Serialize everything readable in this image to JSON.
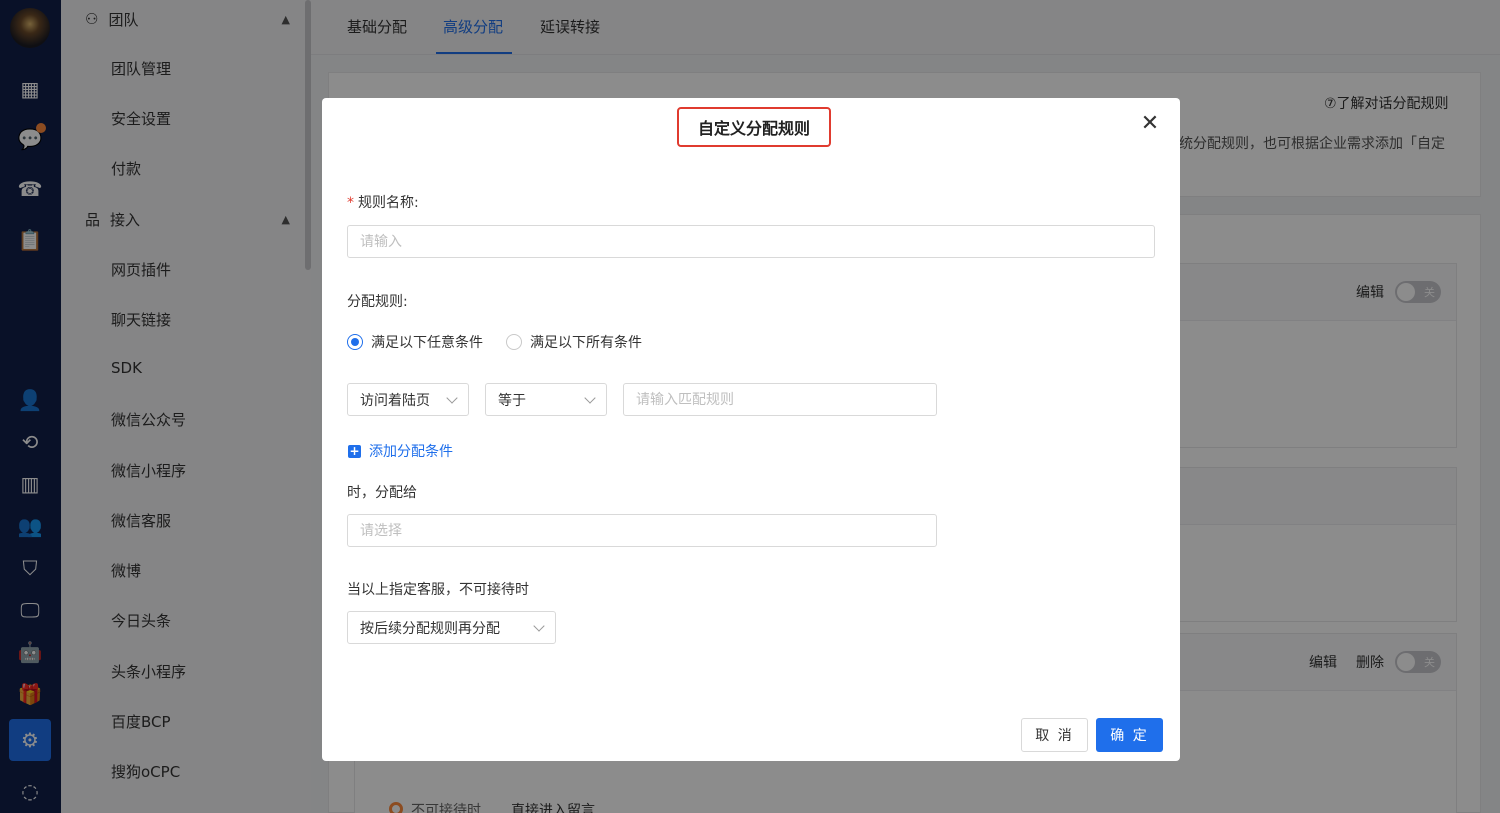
{
  "rail": {
    "icons": [
      "dashboard-icon",
      "chat-icon",
      "phone-icon",
      "clipboard-icon",
      "user-icon",
      "history-icon",
      "bar-chart-icon",
      "team-icon",
      "shield-icon",
      "monitor-icon",
      "robot-icon",
      "gift-icon",
      "settings-icon",
      "whatsapp-icon"
    ]
  },
  "sidebar": {
    "group_team": "团队",
    "team_items": [
      "团队管理",
      "安全设置",
      "付款"
    ],
    "group_access": "接入",
    "access_items": [
      "网页插件",
      "聊天链接",
      "SDK",
      "微信公众号",
      "微信小程序",
      "微信客服",
      "微博",
      "今日头条",
      "头条小程序",
      "百度BCP",
      "搜狗oCPC"
    ]
  },
  "tabs": [
    "基础分配",
    "高级分配",
    "延误转接"
  ],
  "background": {
    "help_link": "⑦了解对话分配规则",
    "desc_fragment": "统分配规则，也可根据企业需求添加「自定",
    "edit": "编辑",
    "delete": "删除",
    "toggle_off": "关",
    "row_label_unavailable": "不可接待时",
    "row_value_unavailable": "直接进入留言"
  },
  "modal": {
    "title": "自定义分配规则",
    "rule_name_label": "规则名称:",
    "rule_name_placeholder": "请输入",
    "assign_rule_label": "分配规则:",
    "radio_any": "满足以下任意条件",
    "radio_all": "满足以下所有条件",
    "cond_field": "访问着陆页",
    "cond_op": "等于",
    "cond_value_placeholder": "请输入匹配规则",
    "add_condition": "添加分配条件",
    "assign_to_label": "时，分配给",
    "assign_to_placeholder": "请选择",
    "fallback_label": "当以上指定客服，不可接待时",
    "fallback_value": "按后续分配规则再分配",
    "cancel": "取 消",
    "confirm": "确 定"
  }
}
